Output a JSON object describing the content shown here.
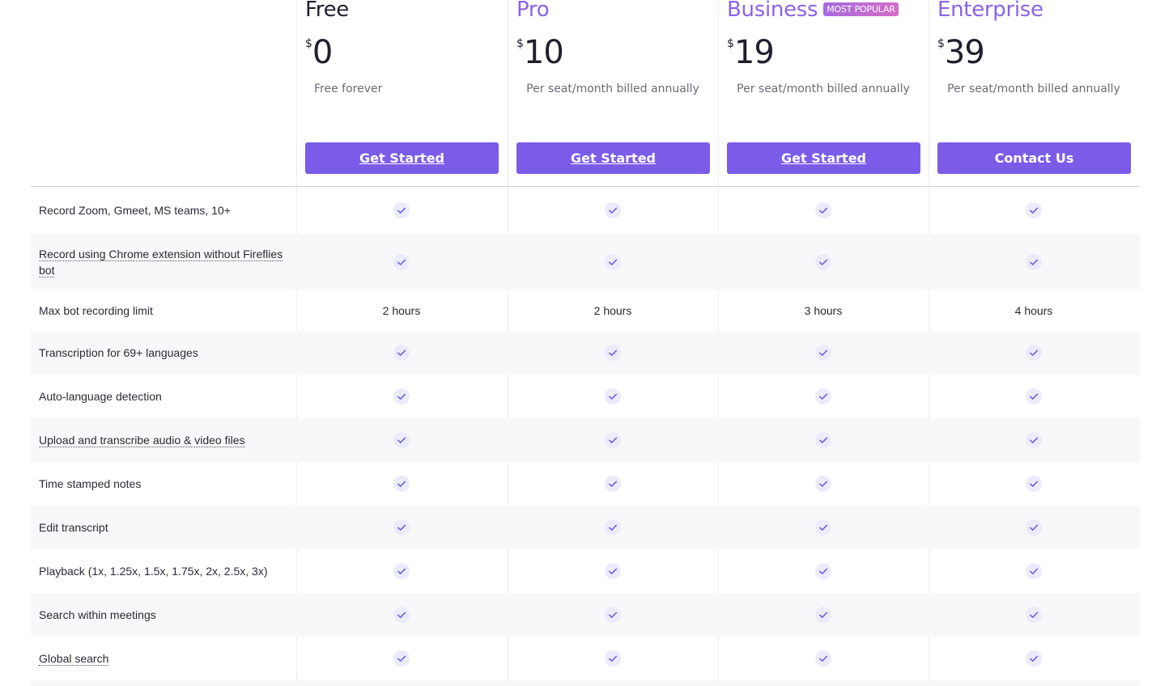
{
  "colors": {
    "accent": "#7b5ce8",
    "plan_name_purple": "#8a63e8",
    "check_bg": "#ecebfb",
    "check_stroke": "#6f5fe0"
  },
  "plans": [
    {
      "name": "Free",
      "currency": "$",
      "price": "0",
      "billing": "Free forever",
      "cta": "Get Started"
    },
    {
      "name": "Pro",
      "currency": "$",
      "price": "10",
      "billing": "Per seat/month billed annually",
      "cta": "Get Started"
    },
    {
      "name": "Business",
      "badge": "MOST POPULAR",
      "currency": "$",
      "price": "19",
      "billing": "Per seat/month billed annually",
      "cta": "Get Started"
    },
    {
      "name": "Enterprise",
      "currency": "$",
      "price": "39",
      "billing": "Per seat/month billed annually",
      "cta": "Contact Us"
    }
  ],
  "features": [
    {
      "label": "Record Zoom, Gmeet, MS teams, 10+",
      "values": [
        "check-icon",
        "check-icon",
        "check-icon",
        "check-icon"
      ]
    },
    {
      "label": "Record using Chrome extension without Fireflies bot",
      "values": [
        "check-icon",
        "check-icon",
        "check-icon",
        "check-icon"
      ]
    },
    {
      "label": "Max bot recording limit",
      "values": [
        "2 hours",
        "2 hours",
        "3 hours",
        "4 hours"
      ]
    },
    {
      "label": "Transcription for 69+ languages",
      "values": [
        "check-icon",
        "check-icon",
        "check-icon",
        "check-icon"
      ]
    },
    {
      "label": "Auto-language detection",
      "values": [
        "check-icon",
        "check-icon",
        "check-icon",
        "check-icon"
      ]
    },
    {
      "label": "Upload and transcribe audio & video files",
      "values": [
        "check-icon",
        "check-icon",
        "check-icon",
        "check-icon"
      ]
    },
    {
      "label": "Time stamped notes",
      "values": [
        "check-icon",
        "check-icon",
        "check-icon",
        "check-icon"
      ]
    },
    {
      "label": "Edit transcript",
      "values": [
        "check-icon",
        "check-icon",
        "check-icon",
        "check-icon"
      ]
    },
    {
      "label": "Playback (1x, 1.25x, 1.5x, 1.75x, 2x, 2.5x, 3x)",
      "values": [
        "check-icon",
        "check-icon",
        "check-icon",
        "check-icon"
      ]
    },
    {
      "label": "Search within meetings",
      "values": [
        "check-icon",
        "check-icon",
        "check-icon",
        "check-icon"
      ]
    },
    {
      "label": "Global search",
      "values": [
        "check-icon",
        "check-icon",
        "check-icon",
        "check-icon"
      ]
    }
  ]
}
